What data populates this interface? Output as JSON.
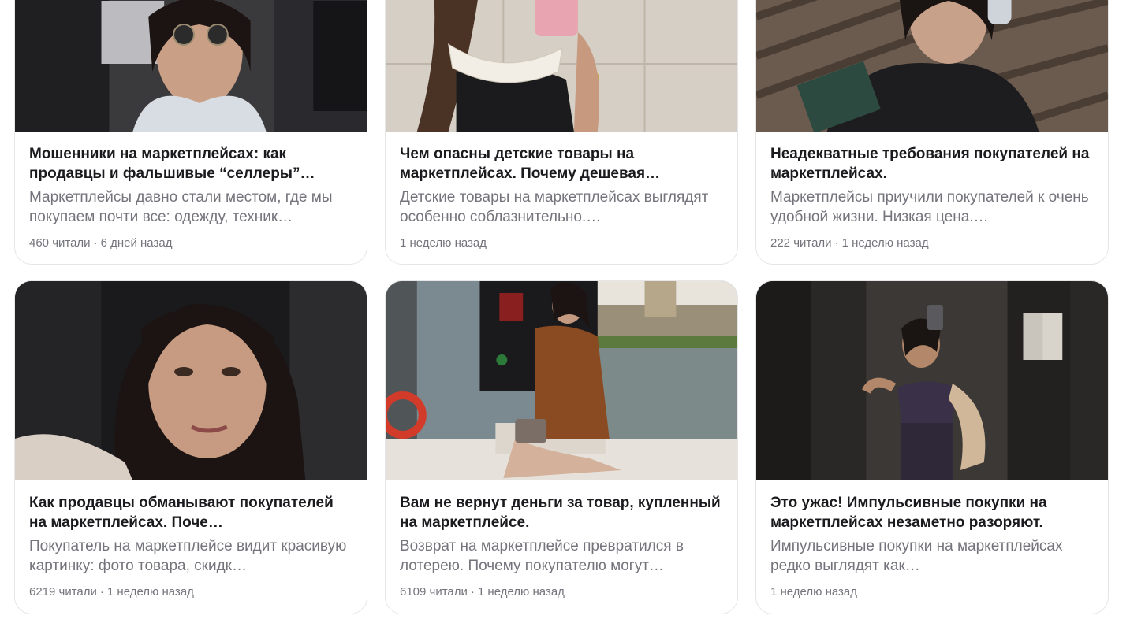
{
  "cards": [
    {
      "title": "Мошенники на маркетплейсах: как продавцы и фальшивые “селлеры”…",
      "description": "Маркетплейсы давно стали местом, где мы покупаем почти все: одежду, техник…",
      "reads": "460 читали",
      "separator": "·",
      "time": "6 дней назад",
      "image": "woman-in-car-sunglasses"
    },
    {
      "title": "Чем опасны детские товары на маркетплейсах. Почему дешевая…",
      "description": "Детские товары на маркетплейсах выглядят особенно соблазнительно.…",
      "reads": "",
      "separator": "",
      "time": "1 неделю назад",
      "image": "woman-mirror-selfie-lace-collar"
    },
    {
      "title": "Неадекватные требования покупателей на маркетплейсах.",
      "description": "Маркетплейсы приучили покупателей к очень удобной жизни. Низкая цена.…",
      "reads": "222 читали",
      "separator": "·",
      "time": "1 неделю назад",
      "image": "woman-headphones-book-bench"
    },
    {
      "title": "Как продавцы обманывают покупателей на маркетплейсах. Поче…",
      "description": "Покупатель на маркетплейсе видит красивую картинку: фото товара, скидк…",
      "reads": "6219 читали",
      "separator": "·",
      "time": "1 неделю назад",
      "image": "woman-selfie-car-seat"
    },
    {
      "title": "Вам не вернут деньги за товар, купленный на маркетплейсе.",
      "description": "Возврат на маркетплейсе превратился в лотерею. Почему покупателю могут…",
      "reads": "6109 читали",
      "separator": "·",
      "time": "1 неделю назад",
      "image": "woman-on-boat-river"
    },
    {
      "title": "Это ужас! Импульсивные покупки на маркетплейсах незаметно разоряют.",
      "description": "Импульсивные покупки на маркетплейсах редко выглядят как…",
      "reads": "",
      "separator": "",
      "time": "1 неделю назад",
      "image": "woman-elevator-mirror-selfie"
    }
  ]
}
